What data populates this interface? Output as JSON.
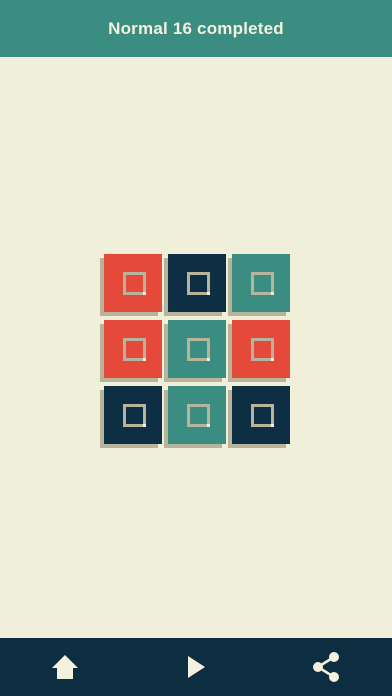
{
  "header": {
    "title": "Normal 16 completed"
  },
  "colors": {
    "header_bg": "#3a8d80",
    "background": "#f0efd9",
    "footer_bg": "#0d2d40",
    "red": "#e5493a",
    "navy": "#0e2f43",
    "teal": "#3a8d80",
    "shadow": "#b8b39b",
    "icon": "#f4f1dc"
  },
  "board": {
    "rows": [
      [
        "red",
        "navy",
        "teal"
      ],
      [
        "red",
        "teal",
        "red"
      ],
      [
        "navy",
        "teal",
        "navy"
      ]
    ]
  },
  "footer": {
    "buttons": [
      {
        "name": "home",
        "icon": "home-icon"
      },
      {
        "name": "play",
        "icon": "play-icon"
      },
      {
        "name": "share",
        "icon": "share-icon"
      }
    ]
  }
}
